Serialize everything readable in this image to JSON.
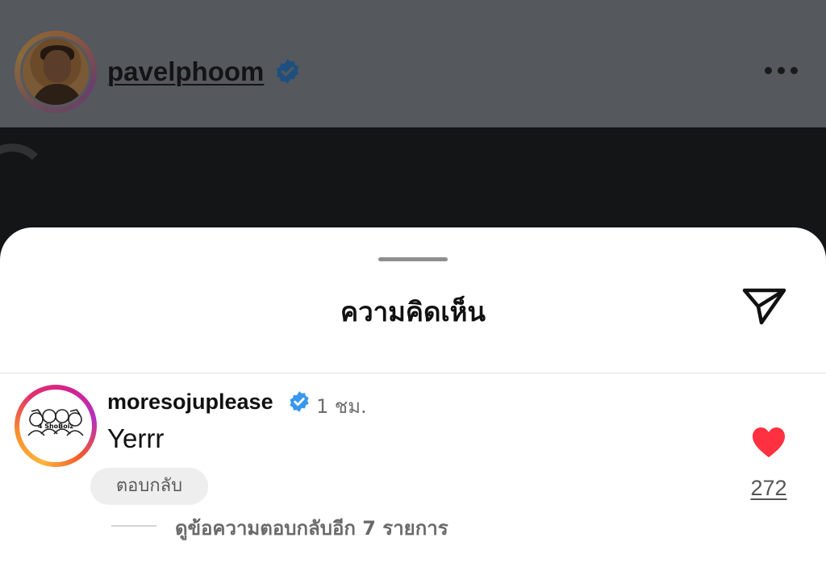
{
  "post": {
    "username": "pavelphoom",
    "verified": true
  },
  "comments_sheet": {
    "title": "ความคิดเห็น",
    "share_icon": "paper-plane-icon"
  },
  "comment": {
    "username": "moresojuplease",
    "verified": true,
    "time": "1 ชม.",
    "text": "Yerrr",
    "reply_label": "ตอบกลับ",
    "like_count": "272",
    "liked": true,
    "view_replies_label": "ดูข้อความตอบกลับอีก 7 รายการ",
    "avatar_logo_text": "4 ShoBoiz"
  },
  "colors": {
    "verified_badge": "#3897f0",
    "like_heart": "#ff3040",
    "story_ring_start": "#fcb43f",
    "story_ring_end": "#d3238b"
  }
}
